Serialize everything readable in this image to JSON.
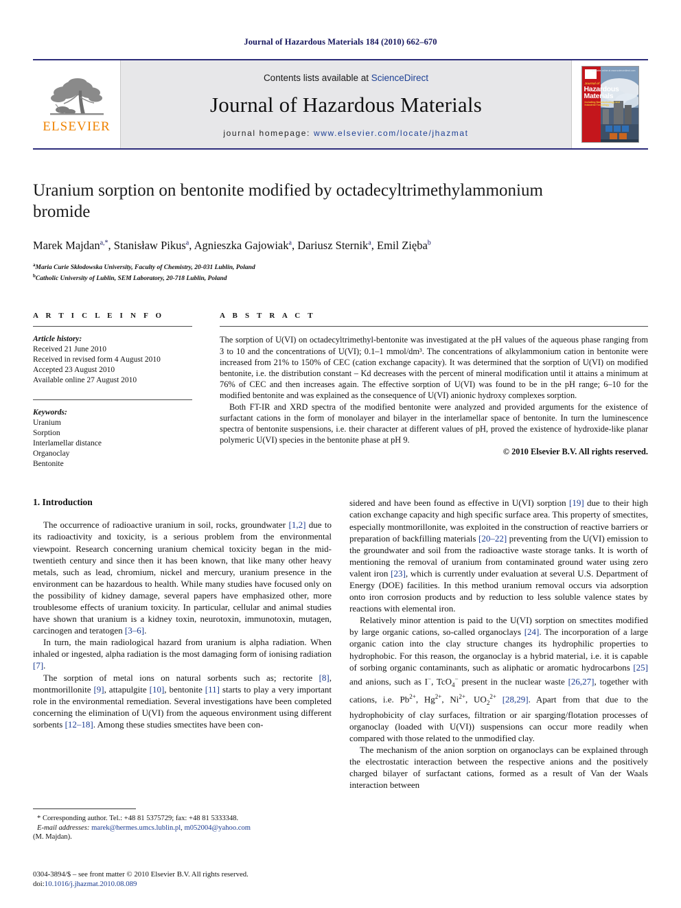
{
  "running_head": "Journal of Hazardous Materials 184 (2010) 662–670",
  "masthead": {
    "contents_prefix": "Contents lists available at ",
    "sciencedirect": "ScienceDirect",
    "journal_title": "Journal of Hazardous Materials",
    "homepage_label": "journal homepage:",
    "homepage_url": "www.elsevier.com/locate/jhazmat",
    "publisher_word": "ELSEVIER",
    "cover": {
      "journal_of": "Journal of",
      "hazardous": "Hazardous",
      "materials": "Materials",
      "subtitle": "Including Nanotoxicology and Industrial Toxicology",
      "top_text": "Available online at www.sciencedirect.com"
    },
    "accent_blue": "#1c3f94",
    "elsevier_orange": "#ef8200",
    "cover_red": "#c4161c"
  },
  "article": {
    "title": "Uranium sorption on bentonite modified by octadecyltrimethylammonium bromide",
    "authors_html": "Marek Majdan<sup class=\"star\">a,*</sup>, Stanisław Pikus<sup>a</sup>, Agnieszka Gajowiak<sup>a</sup>, Dariusz Sternik<sup>a</sup>, Emil Zięba<sup>b</sup>",
    "affiliations": [
      "Maria Curie Skłodowska University, Faculty of Chemistry, 20-031 Lublin, Poland",
      "Catholic University of Lublin, SEM Laboratory, 20-718 Lublin, Poland"
    ],
    "affiliation_marks": [
      "a",
      "b"
    ]
  },
  "article_info": {
    "heading": "A R T I C L E  I N F O",
    "history_label": "Article history:",
    "history": [
      "Received 21 June 2010",
      "Received in revised form 4 August 2010",
      "Accepted 23 August 2010",
      "Available online 27 August 2010"
    ],
    "keywords_label": "Keywords:",
    "keywords": [
      "Uranium",
      "Sorption",
      "Interlamellar distance",
      "Organoclay",
      "Bentonite"
    ]
  },
  "abstract": {
    "heading": "A B S T R A C T",
    "paragraph_1": "The sorption of U(VI) on octadecyltrimethyl-bentonite was investigated at the pH values of the aqueous phase ranging from 3 to 10 and the concentrations of U(VI); 0.1–1 mmol/dm³. The concentrations of alkylammonium cation in bentonite were increased from 21% to 150% of CEC (cation exchange capacity). It was determined that the sorption of U(VI) on modified bentonite, i.e. the distribution constant – Kd decreases with the percent of mineral modification until it attains a minimum at 76% of CEC and then increases again. The effective sorption of U(VI) was found to be in the pH range; 6–10 for the modified bentonite and was explained as the consequence of U(VI) anionic hydroxy complexes sorption.",
    "paragraph_2": "Both FT-IR and XRD spectra of the modified bentonite were analyzed and provided arguments for the existence of surfactant cations in the form of monolayer and bilayer in the interlamellar space of bentonite. In turn the luminescence spectra of bentonite suspensions, i.e. their character at different values of pH, proved the existence of hydroxide-like planar polymeric U(VI) species in the bentonite phase at pH 9.",
    "copyright": "© 2010 Elsevier B.V. All rights reserved."
  },
  "body": {
    "section_heading": "1. Introduction",
    "left_paragraphs": [
      "The occurrence of radioactive uranium in soil, rocks, groundwater [1,2] due to its radioactivity and toxicity, is a serious problem from the environmental viewpoint. Research concerning uranium chemical toxicity began in the mid-twentieth century and since then it has been known, that like many other heavy metals, such as lead, chromium, nickel and mercury, uranium presence in the environment can be hazardous to health. While many studies have focused only on the possibility of kidney damage, several papers have emphasized other, more troublesome effects of uranium toxicity. In particular, cellular and animal studies have shown that uranium is a kidney toxin, neurotoxin, immunotoxin, mutagen, carcinogen and teratogen [3–6].",
      "In turn, the main radiological hazard from uranium is alpha radiation. When inhaled or ingested, alpha radiation is the most damaging form of ionising radiation [7].",
      "The sorption of metal ions on natural sorbents such as; rectorite [8], montmorillonite [9], attapulgite [10], bentonite [11] starts to play a very important role in the environmental remediation. Several investigations have been completed concerning the elimination of U(VI) from the aqueous environment using different sorbents [12–18]. Among these studies smectites have been con-"
    ],
    "right_paragraphs": [
      "sidered and have been found as effective in U(VI) sorption [19] due to their high cation exchange capacity and high specific surface area. This property of smectites, especially montmorillonite, was exploited in the construction of reactive barriers or preparation of backfilling materials [20–22] preventing from the U(VI) emission to the groundwater and soil from the radioactive waste storage tanks. It is worth of mentioning the removal of uranium from contaminated ground water using zero valent iron [23], which is currently under evaluation at several U.S. Department of Energy (DOE) facilities. In this method uranium removal occurs via adsorption onto iron corrosion products and by reduction to less soluble valence states by reactions with elemental iron.",
      "Relatively minor attention is paid to the U(VI) sorption on smectites modified by large organic cations, so-called organoclays [24]. The incorporation of a large organic cation into the clay structure changes its hydrophilic properties to hydrophobic. For this reason, the organoclay is a hybrid material, i.e. it is capable of sorbing organic contaminants, such as aliphatic or aromatic hydrocarbons [25] and anions, such as I⁻, TcO₄⁻ present in the nuclear waste [26,27], together with cations, i.e. Pb²⁺, Hg²⁺, Ni²⁺, UO₂²⁺ [28,29]. Apart from that due to the hydrophobicity of clay surfaces, filtration or air sparging/flotation processes of organoclay (loaded with U(VI)) suspensions can occur more readily when compared with those related to the unmodified clay.",
      "The mechanism of the anion sorption on organoclays can be explained through the electrostatic interaction between the respective anions and the positively charged bilayer of surfactant cations, formed as a result of Van der Waals interaction between"
    ]
  },
  "footnote": {
    "corresponding": "* Corresponding author. Tel.: +48 81 5375729; fax: +48 81 5333348.",
    "email_label": "E-mail addresses:",
    "email_1": "marek@hermes.umcs.lublin.pl",
    "email_2": "m052004@yahoo.com",
    "email_owner": "(M. Majdan)."
  },
  "footer": {
    "issn": "0304-3894/$ – see front matter © 2010 Elsevier B.V. All rights reserved.",
    "doi_label": "doi:",
    "doi_value": "10.1016/j.jhazmat.2010.08.089"
  }
}
